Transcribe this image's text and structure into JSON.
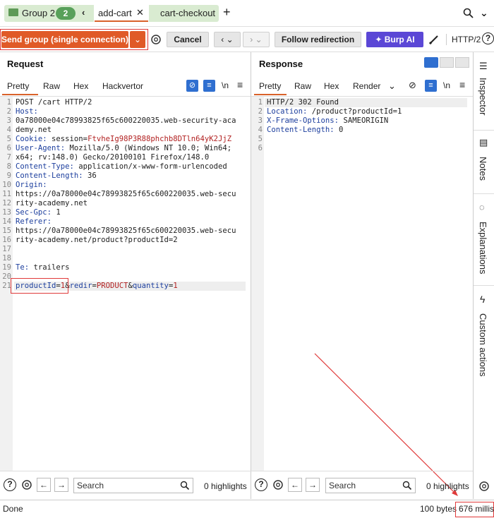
{
  "tabs": {
    "group_label": "Group 2",
    "group_count": "2",
    "tab1": "add-cart",
    "tab2": "cart-checkout",
    "add_tab": "+"
  },
  "toolbar": {
    "send_label": "Send group (single connection)",
    "cancel_label": "Cancel",
    "follow_label": "Follow redirection",
    "burp_ai_label": "Burp AI",
    "http_version": "HTTP/2"
  },
  "request": {
    "title": "Request",
    "tabs": [
      "Pretty",
      "Raw",
      "Hex",
      "Hackvertor"
    ],
    "newline_toggle": "\\n",
    "lines": [
      {
        "n": "1",
        "t": "POST /cart HTTP/2"
      },
      {
        "n": "2",
        "k": "Host:",
        "v": ""
      },
      {
        "n": "",
        "t": "0a78000e04c78993825f65c600220035.web-security-aca"
      },
      {
        "n": "",
        "t": "demy.net"
      },
      {
        "n": "3",
        "k": "Cookie:",
        "v": " session=",
        "r": "FtvheIg98P3R88phchb8DTln64yK2JjZ"
      },
      {
        "n": "4",
        "k": "User-Agent:",
        "v": " Mozilla/5.0 (Windows NT 10.0; Win64;"
      },
      {
        "n": "",
        "t": "x64; rv:148.0) Gecko/20100101 Firefox/148.0"
      },
      {
        "n": "5",
        "k": "Content-Type:",
        "v": " application/x-www-form-urlencoded"
      },
      {
        "n": "6",
        "k": "Content-Length:",
        "v": " 36"
      },
      {
        "n": "7",
        "k": "Origin:",
        "v": ""
      },
      {
        "n": "",
        "t": "https://0a78000e04c78993825f65c600220035.web-secu"
      },
      {
        "n": "",
        "t": "rity-academy.net"
      },
      {
        "n": "8",
        "k": "Sec-Gpc:",
        "v": " 1"
      },
      {
        "n": "9",
        "k": "Referer:",
        "v": ""
      },
      {
        "n": "",
        "t": "https://0a78000e04c78993825f65c600220035.web-secu"
      },
      {
        "n": "",
        "t": "rity-academy.net/product?productId=2"
      },
      {
        "n": "10",
        "k": "Te:",
        "v": " trailers"
      },
      {
        "n": "11",
        "t": ""
      },
      {
        "n": "12",
        "body": true
      }
    ],
    "line_numbers": [
      "1",
      "2",
      "3",
      "4",
      "5",
      "6",
      "7",
      "8",
      "9",
      "10",
      "11",
      "12",
      "13",
      "14",
      "15",
      "16",
      "17",
      "18",
      "19",
      "20",
      "21"
    ],
    "body": {
      "p1k": "productId",
      "p1v": "1",
      "p2k": "redir",
      "p2v": "PRODUCT",
      "p3k": "quantity",
      "p3v": "1"
    }
  },
  "response": {
    "title": "Response",
    "tabs": [
      "Pretty",
      "Raw",
      "Hex",
      "Render"
    ],
    "lines": [
      {
        "n": "1",
        "t": "HTTP/2 302 Found"
      },
      {
        "n": "2",
        "k": "Location:",
        "v": " /product?productId=1"
      },
      {
        "n": "3",
        "k": "X-Frame-Options:",
        "v": " SAMEORIGIN"
      },
      {
        "n": "4",
        "k": "Content-Length:",
        "v": " 0"
      },
      {
        "n": "5",
        "t": ""
      },
      {
        "n": "6",
        "t": ""
      }
    ]
  },
  "sidebar": {
    "inspector": "Inspector",
    "notes": "Notes",
    "explanations": "Explanations",
    "custom_actions": "Custom actions"
  },
  "search": {
    "placeholder": "Search",
    "req_highlights": "0 highlights",
    "resp_highlights": "0 highlights"
  },
  "status": {
    "left": "Done",
    "bytes": "100 bytes",
    "millis": "676 millis"
  }
}
